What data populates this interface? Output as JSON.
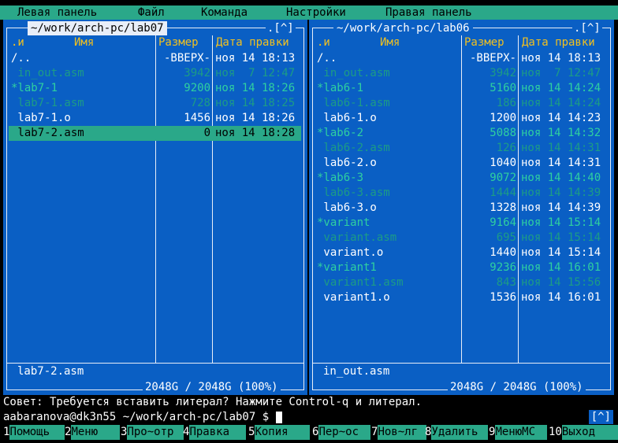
{
  "menu": {
    "left_panel": "Левая панель",
    "file": "Файл",
    "command": "Команда",
    "settings": "Настройки",
    "right_panel": "Правая панель"
  },
  "left": {
    "path": "~/work/arch-pc/lab07",
    "history": ".[^]",
    "col_name_marker": ".и",
    "col_name": "Имя",
    "col_size": "Размер",
    "col_date": "Дата правки",
    "rows": [
      {
        "name": "/..",
        "size": "-ВВЕРХ-",
        "date": "ноя 14 18:13",
        "kind": "dir"
      },
      {
        "name": " in_out.asm",
        "size": "3942",
        "date": "ноя  7 12:47",
        "kind": "asm"
      },
      {
        "name": "*lab7-1",
        "size": "9200",
        "date": "ноя 14 18:26",
        "kind": "exe"
      },
      {
        "name": " lab7-1.asm",
        "size": "728",
        "date": "ноя 14 18:25",
        "kind": "asm"
      },
      {
        "name": " lab7-1.o",
        "size": "1456",
        "date": "ноя 14 18:26",
        "kind": "obj"
      },
      {
        "name": " lab7-2.asm",
        "size": "0",
        "date": "ноя 14 18:28",
        "kind": "sel"
      }
    ],
    "mini_status": "lab7-2.asm",
    "disk": "2048G / 2048G (100%)"
  },
  "right": {
    "path": "~/work/arch-pc/lab06",
    "history": ".[^]",
    "col_name_marker": ".и",
    "col_name": "Имя",
    "col_size": "Размер",
    "col_date": "Дата правки",
    "rows": [
      {
        "name": "/..",
        "size": "-ВВЕРХ-",
        "date": "ноя 14 18:13",
        "kind": "dir"
      },
      {
        "name": " in_out.asm",
        "size": "3942",
        "date": "ноя  7 12:47",
        "kind": "asm"
      },
      {
        "name": "*lab6-1",
        "size": "5160",
        "date": "ноя 14 14:24",
        "kind": "exe"
      },
      {
        "name": " lab6-1.asm",
        "size": "186",
        "date": "ноя 14 14:24",
        "kind": "asm"
      },
      {
        "name": " lab6-1.o",
        "size": "1200",
        "date": "ноя 14 14:23",
        "kind": "obj"
      },
      {
        "name": "*lab6-2",
        "size": "5088",
        "date": "ноя 14 14:32",
        "kind": "exe"
      },
      {
        "name": " lab6-2.asm",
        "size": "126",
        "date": "ноя 14 14:31",
        "kind": "asm"
      },
      {
        "name": " lab6-2.o",
        "size": "1040",
        "date": "ноя 14 14:31",
        "kind": "obj"
      },
      {
        "name": "*lab6-3",
        "size": "9072",
        "date": "ноя 14 14:40",
        "kind": "exe"
      },
      {
        "name": " lab6-3.asm",
        "size": "1444",
        "date": "ноя 14 14:39",
        "kind": "asm"
      },
      {
        "name": " lab6-3.o",
        "size": "1328",
        "date": "ноя 14 14:39",
        "kind": "obj"
      },
      {
        "name": "*variant",
        "size": "9164",
        "date": "ноя 14 15:14",
        "kind": "exe"
      },
      {
        "name": " variant.asm",
        "size": "695",
        "date": "ноя 14 15:14",
        "kind": "asm"
      },
      {
        "name": " variant.o",
        "size": "1440",
        "date": "ноя 14 15:14",
        "kind": "obj"
      },
      {
        "name": "*variant1",
        "size": "9236",
        "date": "ноя 14 16:01",
        "kind": "exe"
      },
      {
        "name": " variant1.asm",
        "size": "843",
        "date": "ноя 14 15:56",
        "kind": "asm"
      },
      {
        "name": " variant1.o",
        "size": "1536",
        "date": "ноя 14 16:01",
        "kind": "obj"
      }
    ],
    "mini_status": "in_out.asm",
    "disk": "2048G / 2048G (100%)"
  },
  "hint": "Совет: Требуется вставить литерал? Нажмите Control-q и литерал.",
  "prompt": "aabaranova@dk3n55 ~/work/arch-pc/lab07 $ ",
  "prompt_arrow": "[^]",
  "fkeys": [
    {
      "num": "1",
      "label": "Помощь"
    },
    {
      "num": "2",
      "label": "Меню"
    },
    {
      "num": "3",
      "label": "Про~отр"
    },
    {
      "num": "4",
      "label": "Правка"
    },
    {
      "num": "5",
      "label": "Копия"
    },
    {
      "num": "6",
      "label": "Пер~ос"
    },
    {
      "num": "7",
      "label": "Нов~лг"
    },
    {
      "num": "8",
      "label": "Удалить"
    },
    {
      "num": "9",
      "label": "МенюМС"
    },
    {
      "num": "10",
      "label": "Выход"
    }
  ],
  "colors": {
    "panel_bg": "#0a5fc4",
    "menu_bg": "#2aa889",
    "header_text": "#f0c020",
    "executable": "#2fd0a0",
    "source_asm": "#1c9c86"
  }
}
